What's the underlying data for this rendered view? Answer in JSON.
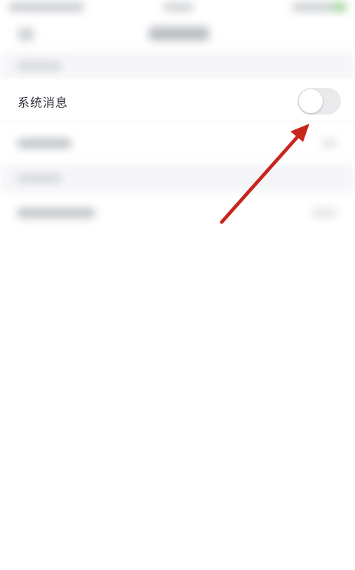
{
  "focused_row": {
    "label": "系统消息",
    "toggle_state": "off"
  },
  "colors": {
    "annotation_arrow": "#c7261f",
    "toggle_off": "#e9eaec",
    "section_bg": "#f4f5f7",
    "text": "#2b2f36"
  },
  "icons": {
    "annotation": "arrow-annotation-icon",
    "toggle": "toggle-switch-icon"
  }
}
